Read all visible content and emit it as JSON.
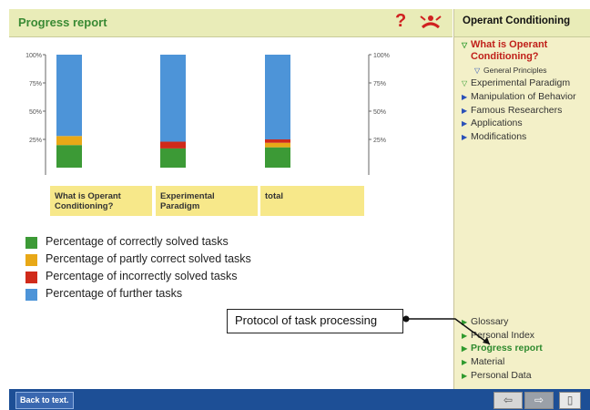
{
  "header": {
    "title": "Progress report",
    "help_icon": "?"
  },
  "sidebar": {
    "title": "Operant Conditioning",
    "top_items": [
      {
        "label": "What is Operant",
        "icon": "triangle-down-icon"
      },
      {
        "label": "Conditioning?"
      },
      {
        "label": "General Principles",
        "icon": "triangle-down-icon"
      },
      {
        "label": "Experimental Paradigm",
        "icon": "triangle-down-icon"
      },
      {
        "label": "Manipulation of Behavior",
        "icon": "triangle-right-icon"
      },
      {
        "label": "Famous Researchers",
        "icon": "triangle-right-icon"
      },
      {
        "label": "Applications",
        "icon": "triangle-right-icon"
      },
      {
        "label": "Modifications",
        "icon": "triangle-right-icon"
      }
    ],
    "bottom_items": [
      {
        "label": "Glossary",
        "icon": "triangle-right-icon"
      },
      {
        "label": "Personal Index",
        "icon": "triangle-right-icon"
      },
      {
        "label": "Progress report",
        "icon": "triangle-right-icon"
      },
      {
        "label": "Material",
        "icon": "triangle-right-icon"
      },
      {
        "label": "Personal Data",
        "icon": "triangle-right-icon"
      }
    ]
  },
  "chart_data": {
    "type": "bar",
    "stacked": true,
    "categories": [
      "What is Operant Conditioning?",
      "Experimental Paradigm",
      "total"
    ],
    "category_lines": [
      [
        "What is Operant",
        "Conditioning?"
      ],
      [
        "Experimental",
        "Paradigm"
      ],
      [
        "total"
      ]
    ],
    "ylim": [
      0,
      100
    ],
    "yticks": [
      "25%",
      "50%",
      "75%",
      "100%"
    ],
    "ytick_values": [
      25,
      50,
      75,
      100
    ],
    "series": [
      {
        "name": "Percentage of correctly solved tasks",
        "color": "#3c9a36",
        "values": [
          20,
          17,
          18
        ]
      },
      {
        "name": "Percentage of partly correct solved tasks",
        "color": "#e8a817",
        "values": [
          8,
          0,
          4
        ]
      },
      {
        "name": "Percentage of incorrectly solved tasks",
        "color": "#d02a1a",
        "values": [
          0,
          6,
          3
        ]
      },
      {
        "name": "Percentage of further tasks",
        "color": "#4d94d8",
        "values": [
          72,
          77,
          75
        ]
      }
    ]
  },
  "legend": [
    {
      "label": "Percentage of correctly solved tasks",
      "color": "#3c9a36"
    },
    {
      "label": "Percentage of partly correct solved tasks",
      "color": "#e8a817"
    },
    {
      "label": "Percentage of incorrectly solved tasks",
      "color": "#d02a1a"
    },
    {
      "label": "Percentage of further tasks",
      "color": "#4d94d8"
    }
  ],
  "annotation": {
    "label": "Protocol of task processing"
  },
  "bottom_bar": {
    "back_label": "Back to text.",
    "prev_icon": "⇦",
    "next_icon": "⇨",
    "layout_icon": "▯"
  }
}
